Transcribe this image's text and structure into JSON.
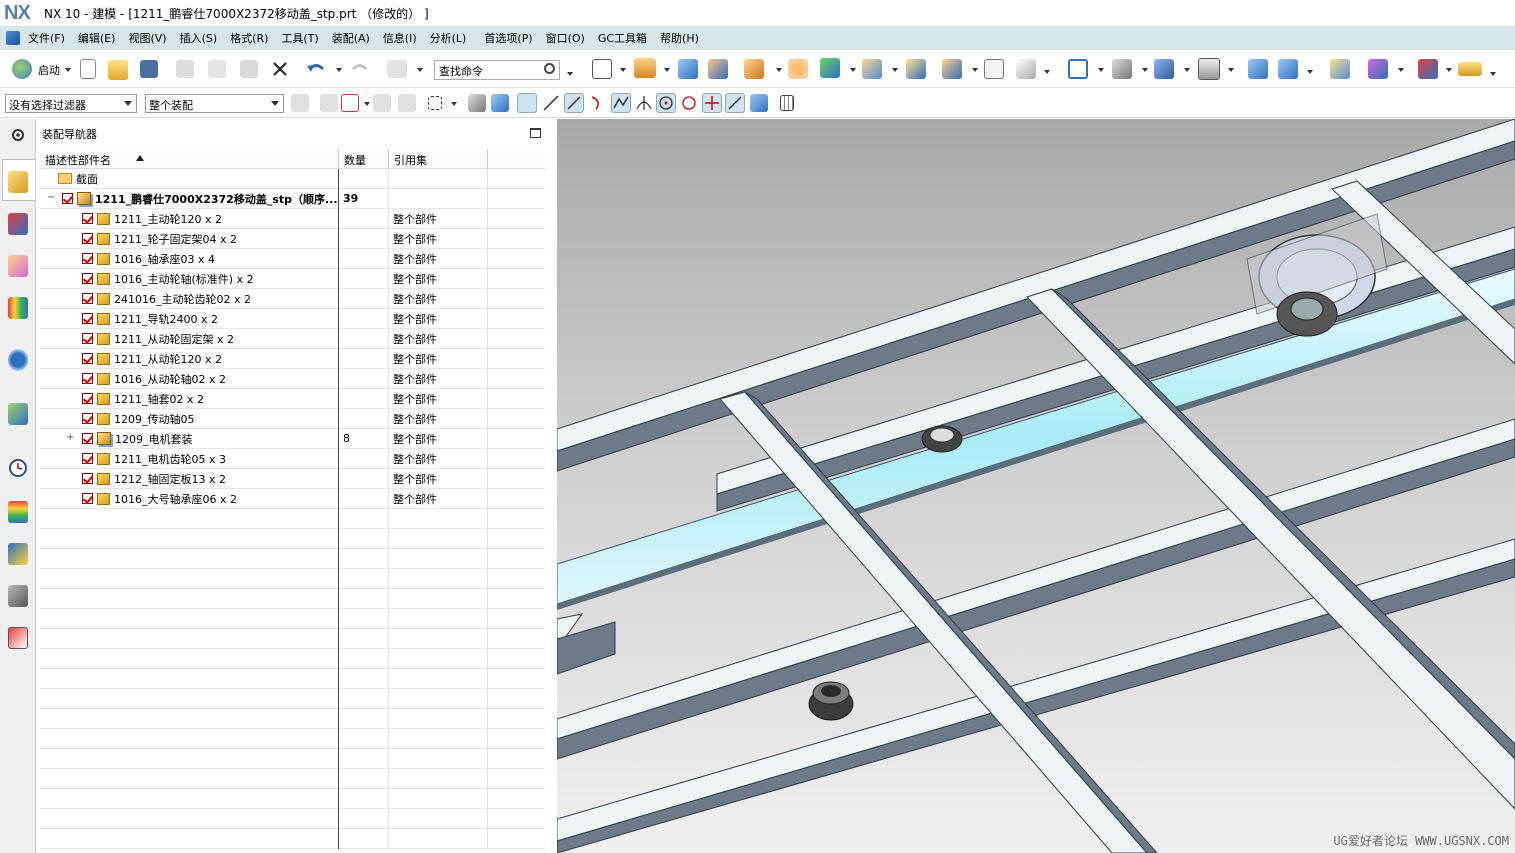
{
  "window": {
    "logo": "NX",
    "title": "NX 10 - 建模 - [1211_鹏睿仕7000X2372移动盖_stp.prt （修改的） ]"
  },
  "menubar": {
    "items": [
      "文件(F)",
      "编辑(E)",
      "视图(V)",
      "插入(S)",
      "格式(R)",
      "工具(T)",
      "装配(A)",
      "信息(I)",
      "分析(L)",
      "首选项(P)",
      "窗口(O)",
      "GC工具箱",
      "帮助(H)"
    ]
  },
  "toolbar": {
    "start_label": "启动",
    "search_placeholder": "查找命令"
  },
  "selection_bar": {
    "filter_value": "没有选择过滤器",
    "scope_value": "整个装配"
  },
  "navigator": {
    "title": "装配导航器",
    "columns": [
      "描述性部件名",
      "数量",
      "引用集"
    ],
    "rows": [
      {
        "name": "截面",
        "qty": "",
        "ref": "",
        "type": "folder"
      },
      {
        "name": "1211_鹏睿仕7000X2372移动盖_stp（顺序...",
        "qty": "39",
        "ref": "",
        "type": "root"
      },
      {
        "name": "1211_主动轮120 x 2",
        "qty": "",
        "ref": "整个部件",
        "type": "part"
      },
      {
        "name": "1211_轮子固定架04 x 2",
        "qty": "",
        "ref": "整个部件",
        "type": "part"
      },
      {
        "name": "1016_轴承座03 x 4",
        "qty": "",
        "ref": "整个部件",
        "type": "part"
      },
      {
        "name": "1016_主动轮轴(标准件) x 2",
        "qty": "",
        "ref": "整个部件",
        "type": "part"
      },
      {
        "name": "241016_主动轮齿轮02 x 2",
        "qty": "",
        "ref": "整个部件",
        "type": "part"
      },
      {
        "name": "1211_导轨2400 x 2",
        "qty": "",
        "ref": "整个部件",
        "type": "part"
      },
      {
        "name": "1211_从动轮固定架 x 2",
        "qty": "",
        "ref": "整个部件",
        "type": "part"
      },
      {
        "name": "1211_从动轮120 x 2",
        "qty": "",
        "ref": "整个部件",
        "type": "part"
      },
      {
        "name": "1016_从动轮轴02 x 2",
        "qty": "",
        "ref": "整个部件",
        "type": "part"
      },
      {
        "name": "1211_轴套02 x 2",
        "qty": "",
        "ref": "整个部件",
        "type": "part"
      },
      {
        "name": "1209_传动轴05",
        "qty": "",
        "ref": "整个部件",
        "type": "part"
      },
      {
        "name": "1209_电机套装",
        "qty": "8",
        "ref": "整个部件",
        "type": "assembly"
      },
      {
        "name": "1211_电机齿轮05 x 3",
        "qty": "",
        "ref": "整个部件",
        "type": "part"
      },
      {
        "name": "1212_轴固定板13 x 2",
        "qty": "",
        "ref": "整个部件",
        "type": "part"
      },
      {
        "name": "1016_大号轴承座06 x 2",
        "qty": "",
        "ref": "整个部件",
        "type": "part"
      }
    ]
  },
  "viewport": {
    "watermark": "UG爱好者论坛 WWW.UGSNX.COM"
  }
}
